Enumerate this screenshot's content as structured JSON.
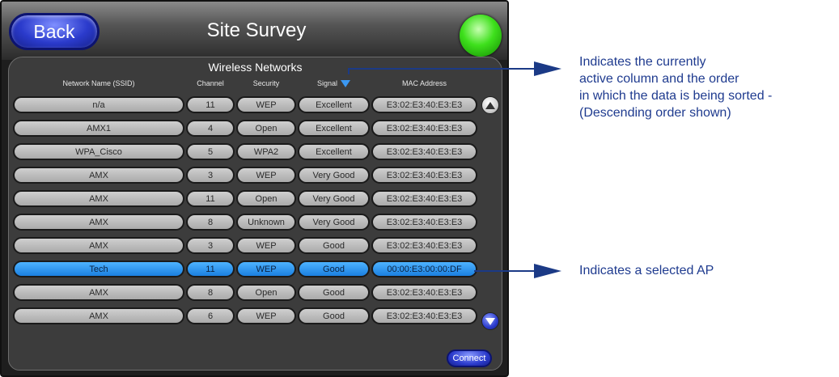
{
  "header": {
    "back_label": "Back",
    "title": "Site Survey"
  },
  "section_title": "Wireless Networks",
  "columns": {
    "ssid": "Network Name (SSID)",
    "channel": "Channel",
    "security": "Security",
    "signal": "Signal",
    "mac": "MAC Address"
  },
  "sort": {
    "column": "signal",
    "order": "descending",
    "accent": "#3b98f2"
  },
  "rows": [
    {
      "ssid": "n/a",
      "channel": "11",
      "security": "WEP",
      "signal": "Excellent",
      "mac": "E3:02:E3:40:E3:E3"
    },
    {
      "ssid": "AMX1",
      "channel": "4",
      "security": "Open",
      "signal": "Excellent",
      "mac": "E3:02:E3:40:E3:E3"
    },
    {
      "ssid": "WPA_Cisco",
      "channel": "5",
      "security": "WPA2",
      "signal": "Excellent",
      "mac": "E3:02:E3:40:E3:E3"
    },
    {
      "ssid": "AMX",
      "channel": "3",
      "security": "WEP",
      "signal": "Very Good",
      "mac": "E3:02:E3:40:E3:E3"
    },
    {
      "ssid": "AMX",
      "channel": "11",
      "security": "Open",
      "signal": "Very Good",
      "mac": "E3:02:E3:40:E3:E3"
    },
    {
      "ssid": "AMX",
      "channel": "8",
      "security": "Unknown",
      "signal": "Very Good",
      "mac": "E3:02:E3:40:E3:E3"
    },
    {
      "ssid": "AMX",
      "channel": "3",
      "security": "WEP",
      "signal": "Good",
      "mac": "E3:02:E3:40:E3:E3"
    },
    {
      "ssid": "Tech",
      "channel": "11",
      "security": "WEP",
      "signal": "Good",
      "mac": "00:00:E3:00:00:DF",
      "selected": true
    },
    {
      "ssid": "AMX",
      "channel": "8",
      "security": "Open",
      "signal": "Good",
      "mac": "E3:02:E3:40:E3:E3"
    },
    {
      "ssid": "AMX",
      "channel": "6",
      "security": "WEP",
      "signal": "Good",
      "mac": "E3:02:E3:40:E3:E3"
    }
  ],
  "connect_label": "Connect",
  "annotations": {
    "sort_lines": [
      "Indicates the currently",
      "active column and the order",
      "in which the data is being sorted -",
      "(Descending order shown)"
    ],
    "selected_text": "Indicates a selected AP"
  },
  "colors": {
    "selected_row": "#2b8ff0",
    "status_light": "#3ee01c",
    "annotation": "#1f3b8f"
  }
}
